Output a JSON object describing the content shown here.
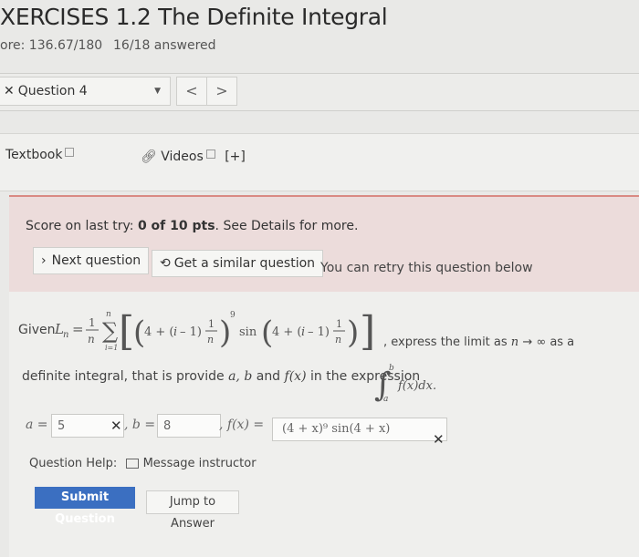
{
  "header": {
    "title": "XERCISES 1.2 The Definite Integral",
    "score": "ore: 136.67/180",
    "answered": "16/18 answered"
  },
  "question_nav": {
    "question_label": "Question 4",
    "prev": "<",
    "next": ">"
  },
  "tools": {
    "textbook": "Textbook",
    "videos": "Videos",
    "videos_plus": "[+]"
  },
  "retry": {
    "score_prefix": "Score on last try: ",
    "score_value": "0 of 10 pts",
    "score_suffix": ". See Details for more.",
    "next_question": "Next question",
    "similar_question": "Get a similar question",
    "retry_msg": "You can retry this question below"
  },
  "question": {
    "given": "Given",
    "tail_text": ", express the limit as",
    "tail_as": "as a",
    "line2_a": "definite integral, that is provide",
    "line2_b": "and",
    "line2_c": "in the expression",
    "a_value": "5",
    "b_value": "8",
    "f_value": "(4 + x)⁹ sin(4 + x)"
  },
  "help": {
    "label": "Question Help:",
    "message": "Message instructor"
  },
  "actions": {
    "submit": "Submit Question",
    "jump": "Jump to Answer"
  }
}
